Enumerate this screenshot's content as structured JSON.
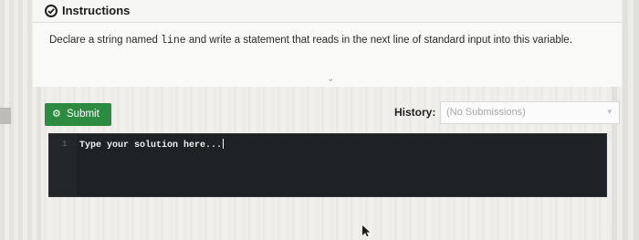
{
  "header": {
    "title": "Instructions",
    "icon": "check-circle-icon"
  },
  "instructions": {
    "text_before": "Declare a string named ",
    "code": "line",
    "text_after": " and write a statement that reads in the next line of standard input into this variable."
  },
  "collapse": {
    "glyph": "⌄"
  },
  "submit": {
    "label": "Submit",
    "icon": "gear-icon",
    "color": "#2d8a41"
  },
  "history": {
    "label": "History:",
    "selected": "(No Submissions)",
    "chevron": "▾"
  },
  "editor": {
    "line_number": "1",
    "placeholder": "Type your solution here...",
    "background": "#1e2224"
  }
}
